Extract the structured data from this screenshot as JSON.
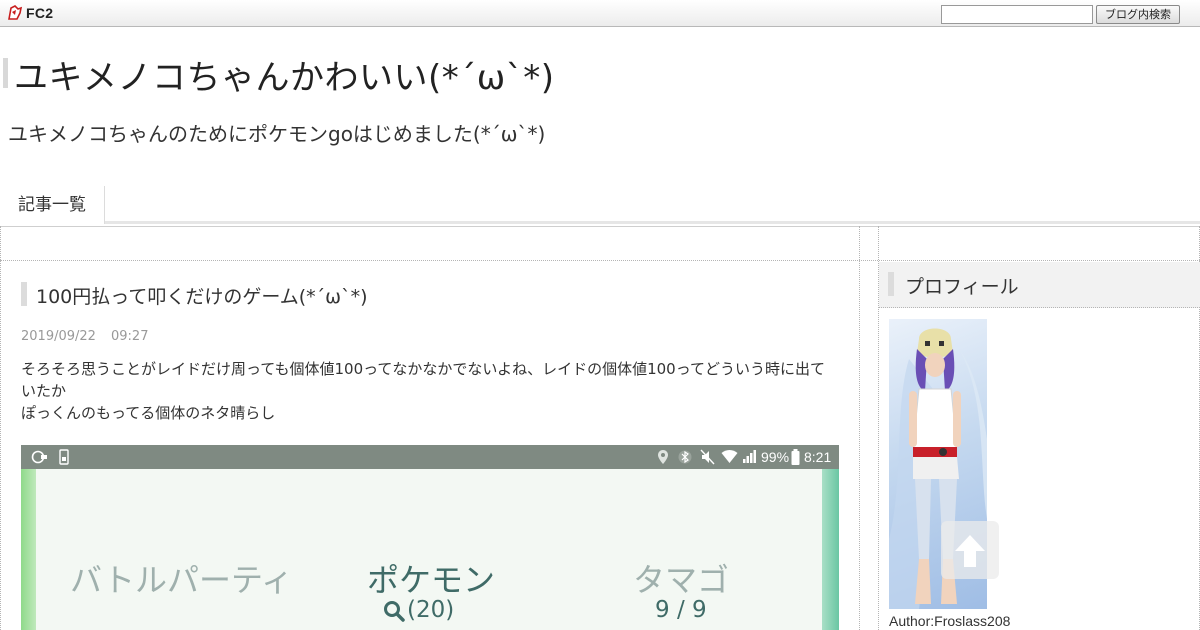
{
  "fc2bar": {
    "logo_text": "FC2",
    "search_placeholder": "",
    "search_button_label": "ブログ内検索"
  },
  "header": {
    "blog_title": "ユキメノコちゃんかわいい(*´ω`*)",
    "blog_description": "ユキメノコちゃんのためにポケモンgoはじめました(*´ω`*)"
  },
  "nav": {
    "items": [
      {
        "label": "記事一覧"
      }
    ]
  },
  "entry": {
    "title": "100円払って叩くだけのゲーム(*´ω`*)",
    "date": "2019/09/22",
    "time": "09:27",
    "body_lines": [
      "そろそろ思うことがレイドだけ周っても個体値100ってなかなかでないよね、レイドの個体値100ってどういう時に出ていたか",
      "ぽっくんのもってる個体のネタ晴らし"
    ],
    "screenshot": {
      "status": {
        "battery": "99%",
        "clock": "8:21"
      },
      "tabs": [
        {
          "label": "バトルパーティ"
        },
        {
          "label": "ポケモン",
          "sub": "(20)"
        },
        {
          "label": "タマゴ",
          "sub": "9 / 9"
        }
      ]
    }
  },
  "sidebar": {
    "profile_heading": "プロフィール",
    "author": "Author:Froslass208"
  },
  "colors": {
    "tab_inactive": "#9fb0ad",
    "tab_active": "#3f6b67",
    "statusbar": "#7f8a82"
  }
}
